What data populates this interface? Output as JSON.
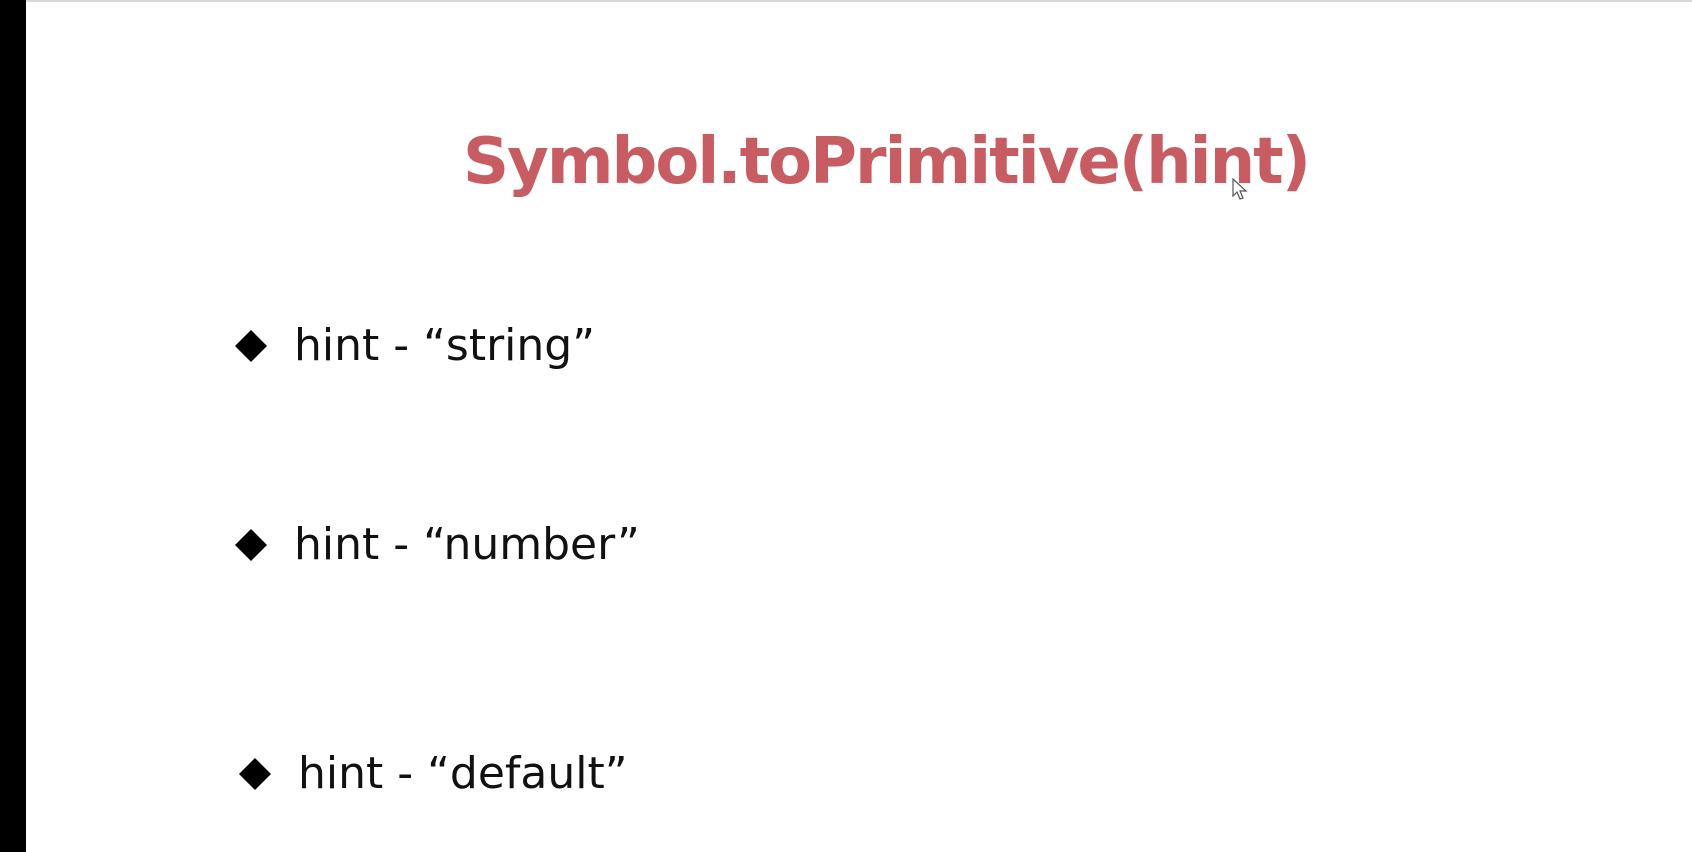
{
  "slide": {
    "title": "Symbol.toPrimitive(hint)",
    "title_color": "#c75d63",
    "bullet_icon": "diamond-icon",
    "bullets": [
      {
        "text": "hint -  “string”"
      },
      {
        "text": "hint -  “number”"
      },
      {
        "text": "hint -  “default”"
      }
    ]
  },
  "cursor_icon": "mouse-pointer-icon"
}
